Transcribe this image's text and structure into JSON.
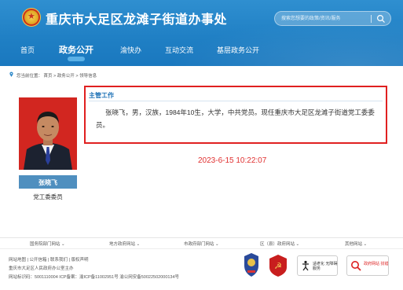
{
  "header": {
    "title": "重庆市大足区龙滩子街道办事处",
    "search_placeholder": "搜索您想要的政策/资讯/服务"
  },
  "nav": {
    "items": [
      "首页",
      "政务公开",
      "渝快办",
      "互动交流",
      "基层政务公开"
    ],
    "active_index": 1
  },
  "breadcrumb": "您当前位置： 首页 > 政务公开 > 领导信息",
  "profile": {
    "name": "张晓飞",
    "role": "党工委委员"
  },
  "info": {
    "section_title": "主管工作",
    "bio": "张晓飞，男，汉族，1984年10生，大学，中共党员。现任重庆市大足区龙滩子街道党工委委员。"
  },
  "timestamp": "2023-6-15 10:22:07",
  "link_groups": [
    "国务院部门网站",
    "地方政府网站",
    "市政府部门网站",
    "区（县）政府网站",
    "其他网站"
  ],
  "footer": {
    "links": "网站地图 | 公开信箱 | 联系我们 | 版权声明",
    "org": "重庆市大足区人民政府办公室主办",
    "ids": "网站标识码：5001110004  ICP备案：渝ICP备11002951号  渝公网安备50022502000134号",
    "badges": [
      "适老化 无障碍服务",
      "政府网站 找错"
    ]
  },
  "colors": {
    "header_blue": "#1f7fc4",
    "highlight_red": "#e02020",
    "timestamp_red": "#e03030",
    "name_bar": "#4f8fbf"
  }
}
